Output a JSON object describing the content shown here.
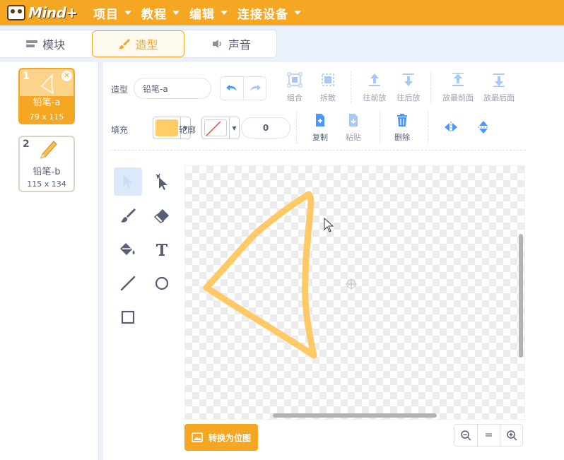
{
  "app": {
    "logo_text": "Mind+"
  },
  "menu": [
    {
      "label": "项目"
    },
    {
      "label": "教程"
    },
    {
      "label": "编辑"
    },
    {
      "label": "连接设备"
    }
  ],
  "tabs": [
    {
      "label": "模块",
      "icon": "blocks-icon"
    },
    {
      "label": "造型",
      "icon": "brush-icon",
      "active": true
    },
    {
      "label": "声音",
      "icon": "speaker-icon"
    }
  ],
  "costumes": [
    {
      "index": "1",
      "name": "铅笔-a",
      "size": "79 x 115",
      "selected": true
    },
    {
      "index": "2",
      "name": "铅笔-b",
      "size": "115 x 134",
      "selected": false
    }
  ],
  "toolbar": {
    "costume_label": "造型",
    "costume_name": "铅笔-a",
    "group": "组合",
    "ungroup": "拆散",
    "forward": "往前放",
    "backward": "往后放",
    "front": "放最前面",
    "back": "放最后面",
    "fill_label": "填充",
    "outline_label": "轮廓",
    "outline_width": "0",
    "copy": "复制",
    "paste": "粘贴",
    "delete": "删除"
  },
  "colors": {
    "accent": "#f5a623",
    "fill_swatch": "#ffcc66",
    "shape_stroke": "#ffc966",
    "tool_active_bg": "#dbe9fb",
    "icon_blue": "#4c97ff"
  },
  "canvas": {
    "convert_label": "转换为位图"
  },
  "zoom": {
    "out": "−",
    "reset": "=",
    "in": "+"
  }
}
